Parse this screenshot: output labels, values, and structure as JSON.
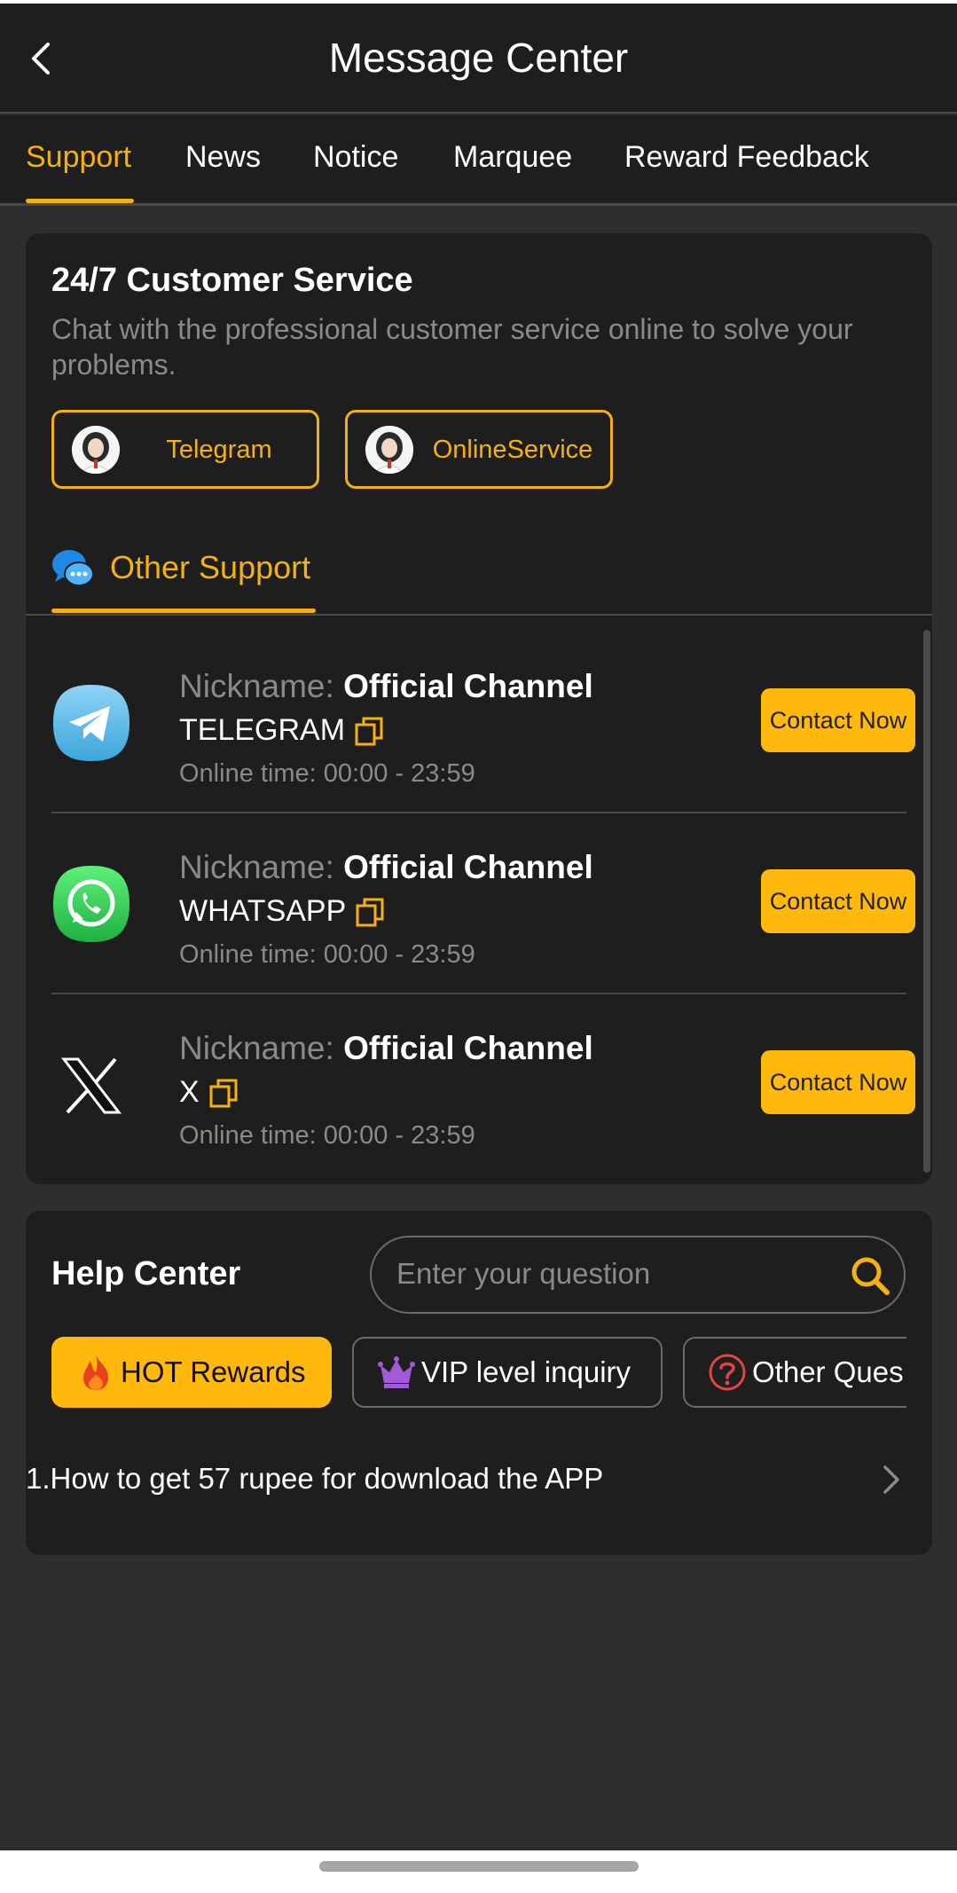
{
  "header": {
    "title": "Message Center",
    "back_icon": "chevron-left-icon"
  },
  "tabs": [
    {
      "label": "Support",
      "active": true
    },
    {
      "label": "News",
      "active": false
    },
    {
      "label": "Notice",
      "active": false
    },
    {
      "label": "Marquee",
      "active": false
    },
    {
      "label": "Reward Feedback",
      "active": false
    }
  ],
  "customer_service": {
    "title": "24/7 Customer Service",
    "description": "Chat with the professional customer service online to solve your problems.",
    "buttons": [
      {
        "label": "Telegram"
      },
      {
        "label": "OnlineService"
      }
    ]
  },
  "other_support": {
    "title": "Other Support",
    "items": [
      {
        "nickname_label": "Nickname:",
        "nickname": "Official Channel",
        "name": "TELEGRAM",
        "online_label": "Online time:",
        "online_time": "00:00 - 23:59",
        "button": "Contact Now",
        "icon": "telegram-icon"
      },
      {
        "nickname_label": "Nickname:",
        "nickname": "Official Channel",
        "name": "WHATSAPP",
        "online_label": "Online time:",
        "online_time": "00:00 - 23:59",
        "button": "Contact Now",
        "icon": "whatsapp-icon"
      },
      {
        "nickname_label": "Nickname:",
        "nickname": "Official Channel",
        "name": "X",
        "online_label": "Online time:",
        "online_time": "00:00 - 23:59",
        "button": "Contact Now",
        "icon": "x-icon"
      }
    ]
  },
  "help_center": {
    "title": "Help Center",
    "search_placeholder": "Enter your question",
    "chips": [
      {
        "label": "HOT Rewards",
        "icon": "fire-icon"
      },
      {
        "label": "VIP level inquiry",
        "icon": "crown-icon"
      },
      {
        "label": "Other Ques",
        "icon": "question-icon"
      }
    ],
    "faq": [
      {
        "label": "1.How to get 57 rupee for download the APP"
      }
    ]
  },
  "colors": {
    "accent": "#f5b10e",
    "button": "#ffb80c",
    "card": "#1e1e1e",
    "background": "#2e2e2e"
  }
}
